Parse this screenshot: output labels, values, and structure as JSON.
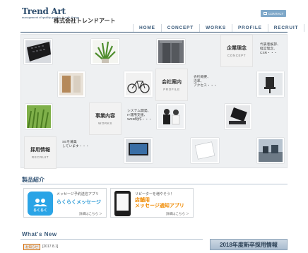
{
  "header": {
    "logo_title": "Trend Art",
    "logo_sub": "management of quality graphic & web design",
    "company_name": "株式会社トレンドアート",
    "contact_label": "CONTACT",
    "accent_color": "#2f4f6f"
  },
  "nav": [
    "HOME",
    "CONCEPT",
    "WORKS",
    "PROFILE",
    "RECRUIT"
  ],
  "mosaic": {
    "concept": {
      "main": "企業理念",
      "sub": "CONCEPT"
    },
    "concept_desc": "代表者挨拶、\n経営理念、\nCSR・・・",
    "profile": {
      "main": "会社案内",
      "sub": "PROFILE"
    },
    "profile_desc": "会社概要、\n沿革、\nアクセス・・・",
    "works": {
      "main": "事業内容",
      "sub": "WORKS"
    },
    "works_desc": "システム開発、\nIT運用支援、\nWEB制作・・・",
    "recruit": {
      "main": "採用情報",
      "sub": "RECRUIT"
    },
    "recruit_desc": "SEを募集\nしています・・・"
  },
  "products": {
    "title": "製品紹介",
    "items": [
      {
        "tag": "メッセージ予約送信アプリ",
        "name": "らくらくメッセージ",
        "icon_label": "らくらく",
        "more": "詳細はこちら ＞"
      },
      {
        "tag": "リピーターを増やそう！",
        "name_line1": "店舗用",
        "name_line2": "メッセージ通知アプリ",
        "more": "詳細はこちら ＞"
      }
    ]
  },
  "news": {
    "title": "What's New",
    "badge": "お知らせ",
    "date": "[2017.8.1]"
  },
  "recruit_banner": "2018年度新卒採用情報"
}
